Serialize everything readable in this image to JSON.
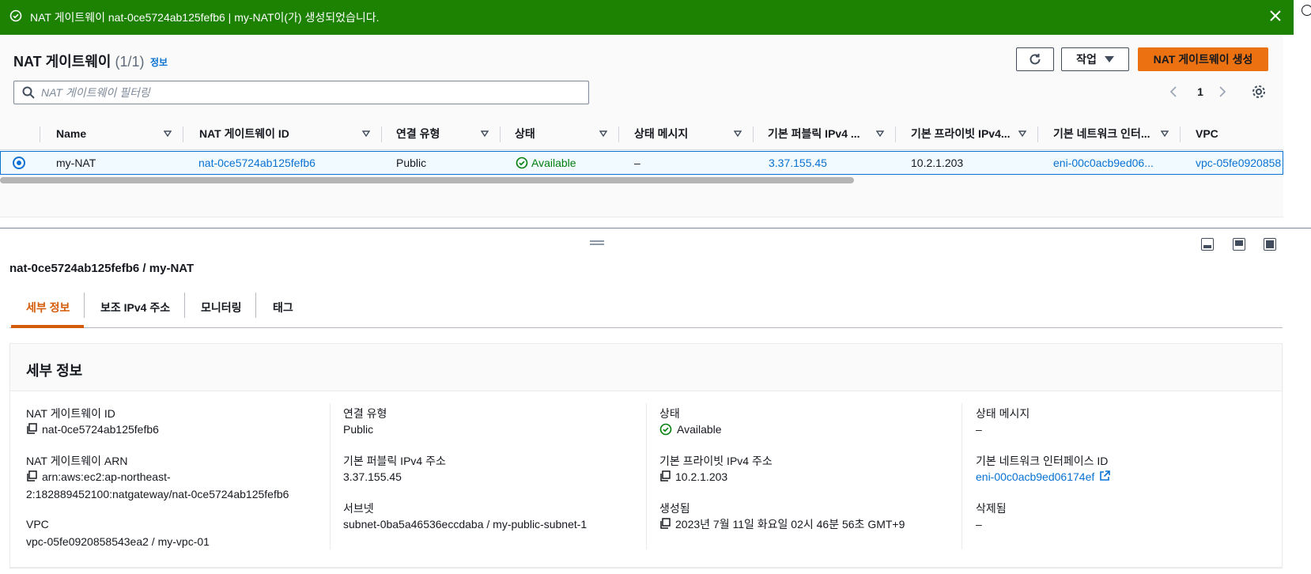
{
  "flash": {
    "message": "NAT 게이트웨이 nat-0ce5724ab125fefb6 | my-NAT이(가) 생성되었습니다.",
    "type": "success",
    "color": "#1d8102"
  },
  "header": {
    "title": "NAT 게이트웨이",
    "count": "(1/1)",
    "info": "정보",
    "actions_label": "작업",
    "create_label": "NAT 게이트웨이 생성"
  },
  "filter": {
    "placeholder": "NAT 게이트웨이 필터링",
    "value": ""
  },
  "pagination": {
    "current": "1"
  },
  "table": {
    "columns": [
      "Name",
      "NAT 게이트웨이 ID",
      "연결 유형",
      "상태",
      "상태 메시지",
      "기본 퍼블릭 IPv4 ...",
      "기본 프라이빗 IPv4...",
      "기본 네트워크 인터...",
      "VPC"
    ],
    "rows": [
      {
        "name": "my-NAT",
        "id": "nat-0ce5724ab125fefb6",
        "connectivity": "Public",
        "state": "Available",
        "state_message": "–",
        "public_ip": "3.37.155.45",
        "private_ip": "10.2.1.203",
        "eni": "eni-00c0acb9ed06...",
        "vpc": "vpc-05fe0920858"
      }
    ]
  },
  "split": {
    "title": "nat-0ce5724ab125fefb6 / my-NAT",
    "tabs": [
      "세부 정보",
      "보조 IPv4 주소",
      "모니터링",
      "태그"
    ],
    "active_tab": "세부 정보"
  },
  "details": {
    "title": "세부 정보",
    "id_label": "NAT 게이트웨이 ID",
    "id_value": "nat-0ce5724ab125fefb6",
    "arn_label": "NAT 게이트웨이 ARN",
    "arn_line1": "arn:aws:ec2:ap-northeast-",
    "arn_line2": "2:182889452100:natgateway/nat-0ce5724ab125fefb6",
    "vpc_label": "VPC",
    "vpc_value": "vpc-05fe0920858543ea2 / my-vpc-01",
    "conn_label": "연결 유형",
    "conn_value": "Public",
    "public_ip_label": "기본 퍼블릭 IPv4 주소",
    "public_ip_value": "3.37.155.45",
    "subnet_label": "서브넷",
    "subnet_value": "subnet-0ba5a46536eccdaba / my-public-subnet-1",
    "state_label": "상태",
    "state_value": "Available",
    "private_ip_label": "기본 프라이빗 IPv4 주소",
    "private_ip_value": "10.2.1.203",
    "created_label": "생성됨",
    "created_value": "2023년 7월 11일 화요일 02시 46분 56초 GMT+9",
    "state_msg_label": "상태 메시지",
    "state_msg_value": "–",
    "eni_label": "기본 네트워크 인터페이스 ID",
    "eni_value": "eni-00c0acb9ed06174ef",
    "deleted_label": "삭제됨",
    "deleted_value": "–"
  },
  "colors": {
    "primary_button": "#ec7211",
    "link": "#0972d3",
    "success": "#037f0c",
    "active_tab": "#d45b07"
  },
  "icons": [
    "success-check-icon",
    "close-icon",
    "refresh-icon",
    "caret-down-icon",
    "search-icon",
    "chevron-left-icon",
    "chevron-right-icon",
    "settings-gear-icon",
    "sort-triangle-icon",
    "copy-icon",
    "external-link-icon",
    "panel-bottom-icon",
    "panel-side-icon",
    "panel-full-icon",
    "drag-handle-icon"
  ]
}
